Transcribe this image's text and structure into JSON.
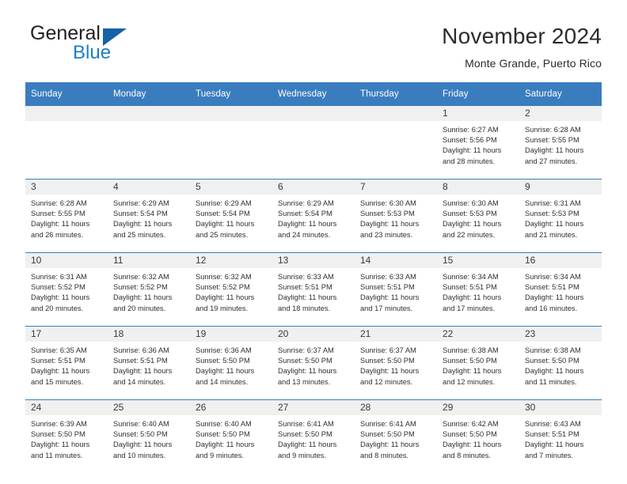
{
  "logo": {
    "word1": "General",
    "word2": "Blue",
    "triangle_color": "#1562a8",
    "blue_color": "#1d7dc4"
  },
  "header": {
    "month_title": "November 2024",
    "location": "Monte Grande, Puerto Rico",
    "header_bg": "#3a7dbf"
  },
  "calendar": {
    "weekday_headers": [
      "Sunday",
      "Monday",
      "Tuesday",
      "Wednesday",
      "Thursday",
      "Friday",
      "Saturday"
    ],
    "weeks": [
      [
        {
          "day": "",
          "empty": true
        },
        {
          "day": "",
          "empty": true
        },
        {
          "day": "",
          "empty": true
        },
        {
          "day": "",
          "empty": true
        },
        {
          "day": "",
          "empty": true
        },
        {
          "day": "1",
          "sunrise": "Sunrise: 6:27 AM",
          "sunset": "Sunset: 5:56 PM",
          "daylight": "Daylight: 11 hours and 28 minutes."
        },
        {
          "day": "2",
          "sunrise": "Sunrise: 6:28 AM",
          "sunset": "Sunset: 5:55 PM",
          "daylight": "Daylight: 11 hours and 27 minutes."
        }
      ],
      [
        {
          "day": "3",
          "sunrise": "Sunrise: 6:28 AM",
          "sunset": "Sunset: 5:55 PM",
          "daylight": "Daylight: 11 hours and 26 minutes."
        },
        {
          "day": "4",
          "sunrise": "Sunrise: 6:29 AM",
          "sunset": "Sunset: 5:54 PM",
          "daylight": "Daylight: 11 hours and 25 minutes."
        },
        {
          "day": "5",
          "sunrise": "Sunrise: 6:29 AM",
          "sunset": "Sunset: 5:54 PM",
          "daylight": "Daylight: 11 hours and 25 minutes."
        },
        {
          "day": "6",
          "sunrise": "Sunrise: 6:29 AM",
          "sunset": "Sunset: 5:54 PM",
          "daylight": "Daylight: 11 hours and 24 minutes."
        },
        {
          "day": "7",
          "sunrise": "Sunrise: 6:30 AM",
          "sunset": "Sunset: 5:53 PM",
          "daylight": "Daylight: 11 hours and 23 minutes."
        },
        {
          "day": "8",
          "sunrise": "Sunrise: 6:30 AM",
          "sunset": "Sunset: 5:53 PM",
          "daylight": "Daylight: 11 hours and 22 minutes."
        },
        {
          "day": "9",
          "sunrise": "Sunrise: 6:31 AM",
          "sunset": "Sunset: 5:53 PM",
          "daylight": "Daylight: 11 hours and 21 minutes."
        }
      ],
      [
        {
          "day": "10",
          "sunrise": "Sunrise: 6:31 AM",
          "sunset": "Sunset: 5:52 PM",
          "daylight": "Daylight: 11 hours and 20 minutes."
        },
        {
          "day": "11",
          "sunrise": "Sunrise: 6:32 AM",
          "sunset": "Sunset: 5:52 PM",
          "daylight": "Daylight: 11 hours and 20 minutes."
        },
        {
          "day": "12",
          "sunrise": "Sunrise: 6:32 AM",
          "sunset": "Sunset: 5:52 PM",
          "daylight": "Daylight: 11 hours and 19 minutes."
        },
        {
          "day": "13",
          "sunrise": "Sunrise: 6:33 AM",
          "sunset": "Sunset: 5:51 PM",
          "daylight": "Daylight: 11 hours and 18 minutes."
        },
        {
          "day": "14",
          "sunrise": "Sunrise: 6:33 AM",
          "sunset": "Sunset: 5:51 PM",
          "daylight": "Daylight: 11 hours and 17 minutes."
        },
        {
          "day": "15",
          "sunrise": "Sunrise: 6:34 AM",
          "sunset": "Sunset: 5:51 PM",
          "daylight": "Daylight: 11 hours and 17 minutes."
        },
        {
          "day": "16",
          "sunrise": "Sunrise: 6:34 AM",
          "sunset": "Sunset: 5:51 PM",
          "daylight": "Daylight: 11 hours and 16 minutes."
        }
      ],
      [
        {
          "day": "17",
          "sunrise": "Sunrise: 6:35 AM",
          "sunset": "Sunset: 5:51 PM",
          "daylight": "Daylight: 11 hours and 15 minutes."
        },
        {
          "day": "18",
          "sunrise": "Sunrise: 6:36 AM",
          "sunset": "Sunset: 5:51 PM",
          "daylight": "Daylight: 11 hours and 14 minutes."
        },
        {
          "day": "19",
          "sunrise": "Sunrise: 6:36 AM",
          "sunset": "Sunset: 5:50 PM",
          "daylight": "Daylight: 11 hours and 14 minutes."
        },
        {
          "day": "20",
          "sunrise": "Sunrise: 6:37 AM",
          "sunset": "Sunset: 5:50 PM",
          "daylight": "Daylight: 11 hours and 13 minutes."
        },
        {
          "day": "21",
          "sunrise": "Sunrise: 6:37 AM",
          "sunset": "Sunset: 5:50 PM",
          "daylight": "Daylight: 11 hours and 12 minutes."
        },
        {
          "day": "22",
          "sunrise": "Sunrise: 6:38 AM",
          "sunset": "Sunset: 5:50 PM",
          "daylight": "Daylight: 11 hours and 12 minutes."
        },
        {
          "day": "23",
          "sunrise": "Sunrise: 6:38 AM",
          "sunset": "Sunset: 5:50 PM",
          "daylight": "Daylight: 11 hours and 11 minutes."
        }
      ],
      [
        {
          "day": "24",
          "sunrise": "Sunrise: 6:39 AM",
          "sunset": "Sunset: 5:50 PM",
          "daylight": "Daylight: 11 hours and 11 minutes."
        },
        {
          "day": "25",
          "sunrise": "Sunrise: 6:40 AM",
          "sunset": "Sunset: 5:50 PM",
          "daylight": "Daylight: 11 hours and 10 minutes."
        },
        {
          "day": "26",
          "sunrise": "Sunrise: 6:40 AM",
          "sunset": "Sunset: 5:50 PM",
          "daylight": "Daylight: 11 hours and 9 minutes."
        },
        {
          "day": "27",
          "sunrise": "Sunrise: 6:41 AM",
          "sunset": "Sunset: 5:50 PM",
          "daylight": "Daylight: 11 hours and 9 minutes."
        },
        {
          "day": "28",
          "sunrise": "Sunrise: 6:41 AM",
          "sunset": "Sunset: 5:50 PM",
          "daylight": "Daylight: 11 hours and 8 minutes."
        },
        {
          "day": "29",
          "sunrise": "Sunrise: 6:42 AM",
          "sunset": "Sunset: 5:50 PM",
          "daylight": "Daylight: 11 hours and 8 minutes."
        },
        {
          "day": "30",
          "sunrise": "Sunrise: 6:43 AM",
          "sunset": "Sunset: 5:51 PM",
          "daylight": "Daylight: 11 hours and 7 minutes."
        }
      ]
    ]
  }
}
